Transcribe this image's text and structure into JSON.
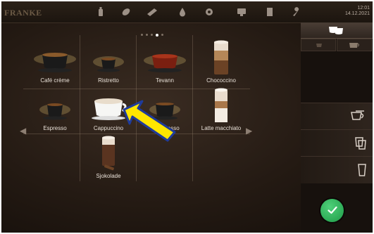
{
  "header": {
    "logo_text": "FRANKE",
    "time": "12:01",
    "date": "14.12.2021",
    "icons": [
      "coffee-bean-icon",
      "leaf-icon",
      "cleaning-icon",
      "water-drop-icon",
      "gear-icon",
      "display-icon",
      "document-icon",
      "wrench-icon"
    ]
  },
  "pager": {
    "pages": 5,
    "active_page": 4
  },
  "products": [
    {
      "label": "Café crème",
      "icon": "cafe-creme-cup"
    },
    {
      "label": "Ristretto",
      "icon": "ristretto-cup"
    },
    {
      "label": "Tevann",
      "icon": "tea-cup"
    },
    {
      "label": "Chococcino",
      "icon": "chococcino-glass"
    },
    {
      "label": "Espresso",
      "icon": "espresso-cup"
    },
    {
      "label": "Cappuccino",
      "icon": "cappuccino-cup"
    },
    {
      "label": "...presso",
      "icon": "espresso-cup"
    },
    {
      "label": "Latte macchiato",
      "icon": "latte-glass"
    },
    {
      "label": "Sjokolade",
      "icon": "chocolate-glass"
    }
  ],
  "right_panel": {
    "top_icon": "cup-stack-icon",
    "segments": [
      "small-cup-icon",
      "large-cup-icon"
    ],
    "sizes": [
      "double-cup-icon",
      "two-glasses-icon",
      "tall-glass-icon"
    ],
    "confirm_icon": "check-icon"
  },
  "colors": {
    "accent_green": "#2fb85c",
    "highlight_arrow": "#ffe600"
  }
}
